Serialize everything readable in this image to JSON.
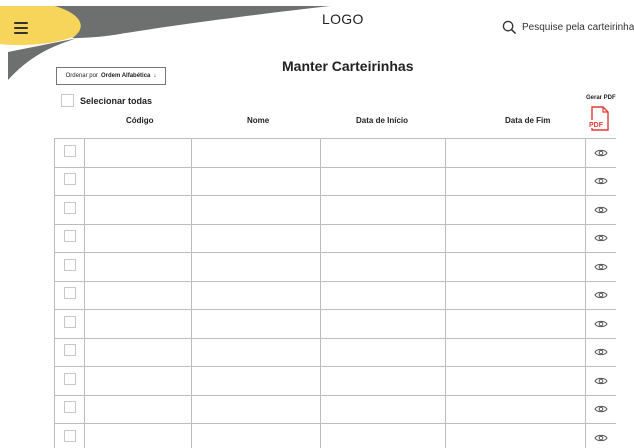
{
  "header": {
    "logo": "LOGO",
    "search_label": "Pesquise pela carteirinha..."
  },
  "page": {
    "title": "Manter Carteirinhas"
  },
  "sort": {
    "prefix": "Ordenar por",
    "value": "Ordem Alfabética"
  },
  "select_all_label": "Selecionar todas",
  "pdf": {
    "label": "Gerar PDF",
    "icon_text": "PDF"
  },
  "columns": [
    "Código",
    "Nome",
    "Data de Início",
    "Data de Fim"
  ],
  "colors": {
    "accent_yellow": "#f7d55a",
    "decor_gray": "#6d706f",
    "pdf_red": "#e53935"
  },
  "row_count": 11
}
